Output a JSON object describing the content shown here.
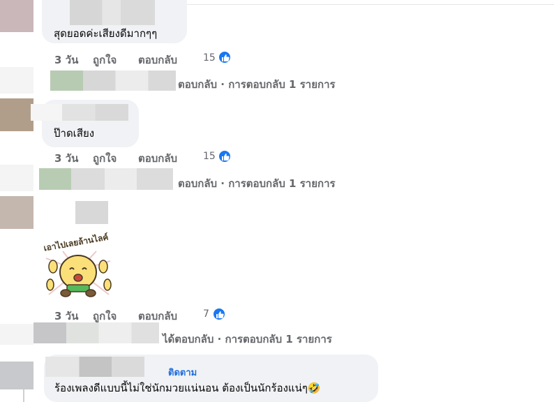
{
  "comments": [
    {
      "text": "สุดยอดค่ะเสียงดีมากๆๆ",
      "time": "3 วัน",
      "like_label": "ถูกใจ",
      "reply_label": "ตอบกลับ",
      "reaction_count": "15",
      "replies_summary": "ตอบกลับ · การตอบกลับ 1 รายการ"
    },
    {
      "text": "ป๊าดเสียง",
      "time": "3 วัน",
      "like_label": "ถูกใจ",
      "reply_label": "ตอบกลับ",
      "reaction_count": "15",
      "replies_summary": "ตอบกลับ · การตอบกลับ 1 รายการ"
    },
    {
      "sticker": "laughing-character-sticker",
      "sticker_text": "เอาไปเลยล้านไลค์",
      "time": "3 วัน",
      "like_label": "ถูกใจ",
      "reply_label": "ตอบกลับ",
      "reaction_count": "7",
      "replies_summary": "ได้ตอบกลับ · การตอบกลับ 1 รายการ"
    },
    {
      "follow_label": "ติดตาม",
      "text": "ร้องเพลงดีแบบนี้ไม่ใช่นักมวยแน่นอน ต้องเป็นนักร้องแน่ๆ",
      "emoji": "🤣"
    }
  ],
  "colors": {
    "bubble": "#f0f2f5",
    "like_blue": "#1877f2",
    "muted_text": "#65676b",
    "link_blue": "#216fdb"
  },
  "icons": {
    "reaction": "thumbs-up-icon"
  }
}
